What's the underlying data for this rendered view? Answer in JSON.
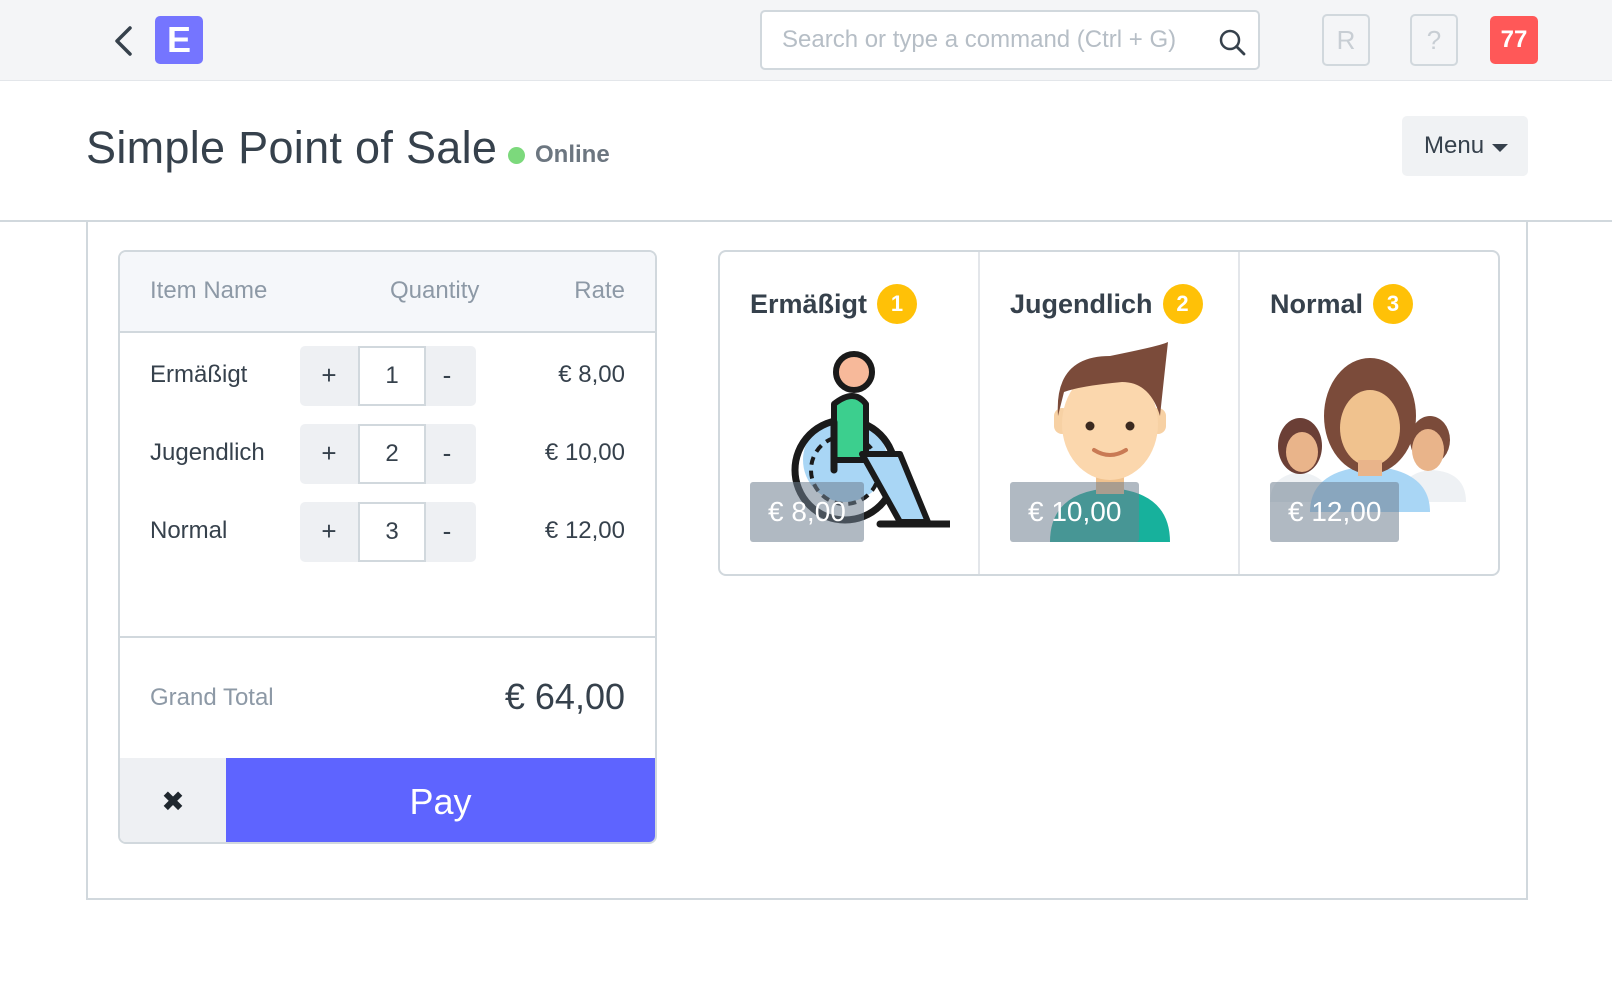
{
  "navbar": {
    "logo_letter": "E",
    "search_placeholder": "Search or type a command (Ctrl + G)",
    "button_r": "R",
    "button_help": "?",
    "notification_count": "77"
  },
  "page": {
    "title": "Simple Point of Sale",
    "status": "Online",
    "menu_label": "Menu"
  },
  "cart": {
    "headers": {
      "item": "Item Name",
      "quantity": "Quantity",
      "rate": "Rate"
    },
    "items": [
      {
        "name": "Ermäßigt",
        "qty": "1",
        "rate": "€ 8,00",
        "plus": "+",
        "minus": "-"
      },
      {
        "name": "Jugendlich",
        "qty": "2",
        "rate": "€ 10,00",
        "plus": "+",
        "minus": "-"
      },
      {
        "name": "Normal",
        "qty": "3",
        "rate": "€ 12,00",
        "plus": "+",
        "minus": "-"
      }
    ],
    "total_label": "Grand Total",
    "total_value": "€ 64,00",
    "clear_symbol": "✖",
    "pay_label": "Pay"
  },
  "products": [
    {
      "name": "Ermäßigt",
      "badge": "1",
      "price": "€ 8,00",
      "icon": "wheelchair-user-icon"
    },
    {
      "name": "Jugendlich",
      "badge": "2",
      "price": "€ 10,00",
      "icon": "young-person-icon"
    },
    {
      "name": "Normal",
      "badge": "3",
      "price": "€ 12,00",
      "icon": "adult-group-icon"
    }
  ],
  "colors": {
    "accent": "#5e64ff",
    "logo": "#7575ff",
    "notification": "#ff5858",
    "badge": "#ffc107",
    "online": "#7cd97c"
  }
}
